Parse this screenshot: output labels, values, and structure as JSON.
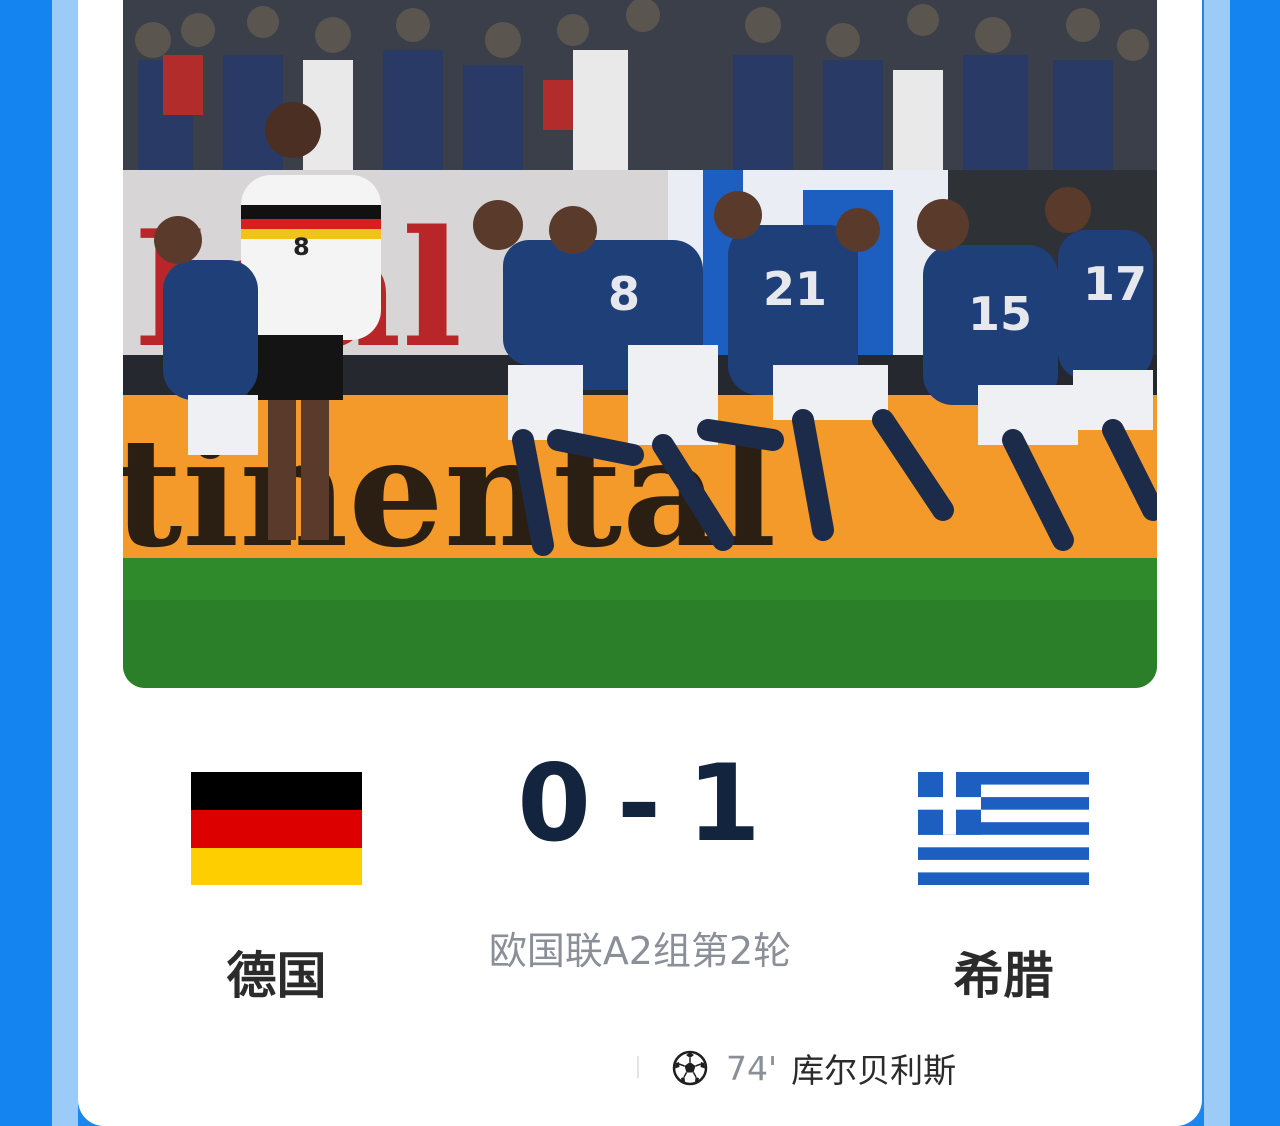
{
  "match": {
    "home_team": "德国",
    "away_team": "希腊",
    "home_score": "0",
    "separator": "-",
    "away_score": "1",
    "competition": "欧国联A2组第2轮",
    "goals": [
      {
        "icon": "soccer-ball-icon",
        "minute": "74'",
        "scorer": "库尔贝利斯"
      }
    ]
  },
  "colors": {
    "score": "#13243f",
    "team_name": "#2b2b2b",
    "muted": "#8a8f98",
    "greek_blue": "#1c5fc0",
    "frame_blue": "#1384f0"
  }
}
